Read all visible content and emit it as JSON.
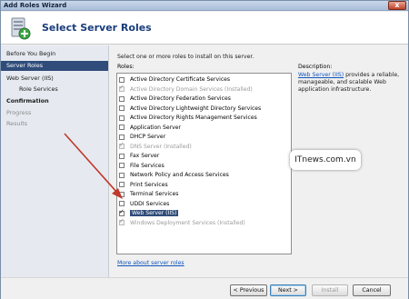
{
  "window": {
    "title": "Add Roles Wizard",
    "close_glyph": "x"
  },
  "header": {
    "heading": "Select Server Roles",
    "icon": "server-roles-icon"
  },
  "nav": {
    "items": [
      {
        "label": "Before You Begin"
      },
      {
        "label": "Server Roles"
      },
      {
        "label": "Web Server (IIS)"
      },
      {
        "label": "Role Services"
      },
      {
        "label": "Confirmation"
      },
      {
        "label": "Progress"
      },
      {
        "label": "Results"
      }
    ]
  },
  "content": {
    "instruction": "Select one or more roles to install on this server.",
    "roles_label": "Roles:",
    "description_label": "Description:",
    "description_link": "Web Server (IIS)",
    "description_text": " provides a reliable, manageable, and scalable Web application infrastructure.",
    "roles": [
      {
        "label": "Active Directory Certificate Services",
        "checked": false,
        "disabled": false
      },
      {
        "label": "Active Directory Domain Services  (Installed)",
        "checked": true,
        "disabled": true
      },
      {
        "label": "Active Directory Federation Services",
        "checked": false,
        "disabled": false
      },
      {
        "label": "Active Directory Lightweight Directory Services",
        "checked": false,
        "disabled": false
      },
      {
        "label": "Active Directory Rights Management Services",
        "checked": false,
        "disabled": false
      },
      {
        "label": "Application Server",
        "checked": false,
        "disabled": false
      },
      {
        "label": "DHCP Server",
        "checked": false,
        "disabled": false
      },
      {
        "label": "DNS Server  (Installed)",
        "checked": true,
        "disabled": true
      },
      {
        "label": "Fax Server",
        "checked": false,
        "disabled": false
      },
      {
        "label": "File Services",
        "checked": false,
        "disabled": false
      },
      {
        "label": "Network Policy and Access Services",
        "checked": false,
        "disabled": false
      },
      {
        "label": "Print Services",
        "checked": false,
        "disabled": false
      },
      {
        "label": "Terminal Services",
        "checked": false,
        "disabled": false
      },
      {
        "label": "UDDI Services",
        "checked": false,
        "disabled": false
      },
      {
        "label": "Web Server (IIS)",
        "checked": true,
        "disabled": false,
        "selected": true
      },
      {
        "label": "Windows Deployment Services  (Installed)",
        "checked": true,
        "disabled": true
      }
    ],
    "more_link": "More about server roles"
  },
  "watermark": "ITnews.com.vn",
  "footer": {
    "previous_label": "< Previous",
    "next_label": "Next >",
    "install_label": "Install",
    "cancel_label": "Cancel"
  },
  "colors": {
    "selection": "#2f4c7a",
    "link": "#1155bb",
    "arrow": "#c0392b",
    "heading": "#1a3d7c"
  }
}
